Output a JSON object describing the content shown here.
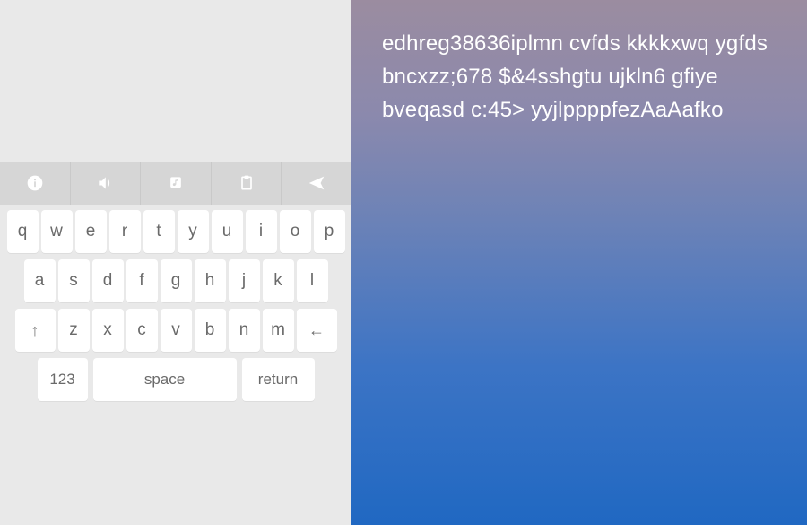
{
  "toolbar": {
    "icons": [
      "info-icon",
      "volume-icon",
      "music-note-icon",
      "clipboard-icon",
      "send-icon"
    ]
  },
  "keyboard": {
    "row1": [
      "q",
      "w",
      "e",
      "r",
      "t",
      "y",
      "u",
      "i",
      "o",
      "p"
    ],
    "row2": [
      "a",
      "s",
      "d",
      "f",
      "g",
      "h",
      "j",
      "k",
      "l"
    ],
    "row3": {
      "shift": "↑",
      "letters": [
        "z",
        "x",
        "c",
        "v",
        "b",
        "n",
        "m"
      ],
      "backspace": "←"
    },
    "row4": {
      "numbers": "123",
      "space": "space",
      "return": "return"
    }
  },
  "output_text": "edhreg38636iplmn cvfds  kkkkxwq ygfds   bncxzz;678  $&4sshgtu ujkln6 gfiye bveqasd  c:45> yyjlppppfezAaAafko"
}
